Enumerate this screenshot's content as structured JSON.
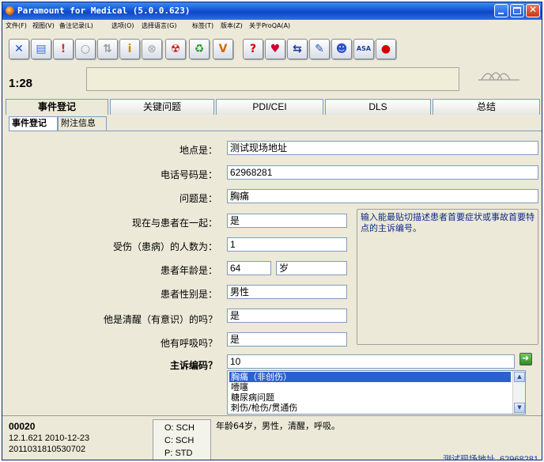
{
  "window": {
    "title": "Paramount for Medical (5.0.0.623)"
  },
  "menu": [
    "文件(F)",
    "视图(V)",
    "备注记录(L)",
    "选项(O)",
    "选择语言(G)",
    "标签(T)",
    "版本(Z)",
    "关于ProQA(A)"
  ],
  "toolbar": {
    "buttons": [
      {
        "name": "close-case-icon",
        "glyph": "✕",
        "color": "#1b4fc2"
      },
      {
        "name": "document-icon",
        "glyph": "▤",
        "color": "#3a6fd8"
      },
      {
        "name": "alert-icon",
        "glyph": "!",
        "color": "#c0392b"
      },
      {
        "name": "circle-icon",
        "glyph": "○",
        "color": "#9a9a9a"
      },
      {
        "name": "sort-icon",
        "glyph": "⇅",
        "color": "#9a9a9a"
      },
      {
        "name": "info-icon",
        "glyph": "i",
        "color": "#d08a00"
      },
      {
        "name": "disabled-x-icon",
        "glyph": "⊗",
        "color": "#b0b0b0"
      },
      {
        "name": "hazard-icon",
        "glyph": "☢",
        "color": "#d0201a"
      },
      {
        "name": "recycle-icon",
        "glyph": "♻",
        "color": "#2e9a2e"
      },
      {
        "name": "volume-icon",
        "glyph": "V",
        "color": "#d06a00"
      },
      {
        "name": "help-icon",
        "glyph": "?",
        "color": "#cc0000"
      },
      {
        "name": "heart-icon",
        "glyph": "♥",
        "color": "#cc0033"
      },
      {
        "name": "transfer-icon",
        "glyph": "⇆",
        "color": "#1a3a9a"
      },
      {
        "name": "pen-icon",
        "glyph": "✎",
        "color": "#2a5aa8"
      },
      {
        "name": "people-icon",
        "glyph": "☻",
        "color": "#3050c8"
      },
      {
        "name": "asa-icon",
        "glyph": "ASA",
        "color": "#2040a0"
      },
      {
        "name": "stop-icon",
        "glyph": "●",
        "color": "#d40000"
      }
    ]
  },
  "timer": "1:28",
  "tabs": [
    "事件登记",
    "关键问题",
    "PDI/CEI",
    "DLS",
    "总结"
  ],
  "subtabs": [
    "事件登记",
    "附注信息"
  ],
  "form": {
    "location_label": "地点是：",
    "location_value": "测试现场地址",
    "phone_label": "电话号码是：",
    "phone_value": "62968281",
    "problem_label": "问题是：",
    "problem_value": "胸痛",
    "with_patient_label": "现在与患者在一起：",
    "with_patient_value": "是",
    "num_hurt_label": "受伤（患病）的人数为：",
    "num_hurt_value": "1",
    "age_label": "患者年龄是：",
    "age_value": "64",
    "age_unit": "岁",
    "gender_label": "患者性别是：",
    "gender_value": "男性",
    "conscious_label": "他是清醒（有意识）的吗？",
    "conscious_value": "是",
    "breathing_label": "他有呼吸吗？",
    "breathing_value": "是",
    "chief_label": "主诉编码？",
    "chief_value": "10",
    "hint": "输入能最贴切描述患者首要症状或事故首要特点的主诉编号。",
    "complaints": [
      "胸痛（非创伤）",
      "噎噻",
      "糖尿病问题",
      "刺伤/枪伤/贯通伤"
    ]
  },
  "status": {
    "case_id": "00020",
    "line2": "12.1.621  2010-12-23",
    "line3": "2011031810530702",
    "codes": [
      "O: SCH",
      "C: SCH",
      "P: STD"
    ],
    "summary": "年龄64岁，男性，清醒，呼吸。",
    "address": "测试现场地址, 62968281"
  }
}
